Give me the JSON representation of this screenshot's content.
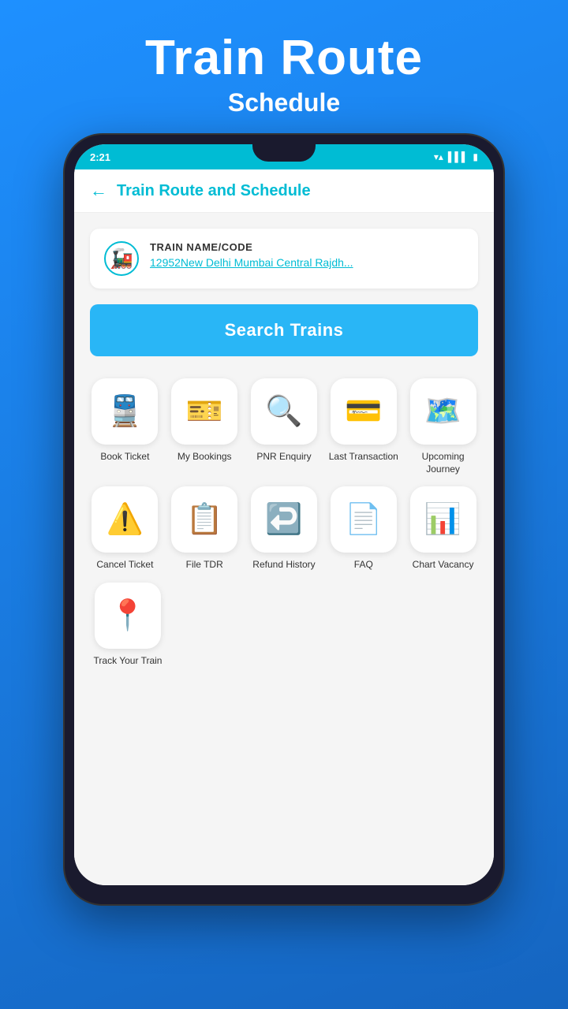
{
  "header": {
    "title": "Train Route",
    "subtitle": "Schedule"
  },
  "status_bar": {
    "time": "2:21",
    "icons": [
      "●",
      "▲",
      "▮",
      "▸",
      "▸"
    ]
  },
  "app_header": {
    "back_label": "←",
    "title": "Train Route and Schedule"
  },
  "train_card": {
    "label": "TRAIN NAME/CODE",
    "train_name": "12952New Delhi Mumbai Central Rajdh..."
  },
  "search_button": {
    "label": "Search Trains"
  },
  "grid": {
    "rows": [
      [
        {
          "id": "book-ticket",
          "label": "Book\nTicket",
          "icon": "🚆",
          "icon_class": "icon-book"
        },
        {
          "id": "my-bookings",
          "label": "My\nBookings",
          "icon": "🎫",
          "icon_class": "icon-booking"
        },
        {
          "id": "pnr-enquiry",
          "label": "PNR\nEnquiry",
          "icon": "🔍",
          "icon_class": "icon-pnr"
        },
        {
          "id": "last-transaction",
          "label": "Last\nTransaction",
          "icon": "💳",
          "icon_class": "icon-transaction"
        },
        {
          "id": "upcoming-journey",
          "label": "Upcoming\nJourney",
          "icon": "🗺️",
          "icon_class": "icon-upcoming"
        }
      ],
      [
        {
          "id": "cancel-ticket",
          "label": "Cancel\nTicket",
          "icon": "⚠️",
          "icon_class": "icon-cancel"
        },
        {
          "id": "file-tdr",
          "label": "File TDR",
          "icon": "📋",
          "icon_class": "icon-tdr"
        },
        {
          "id": "refund-history",
          "label": "Refund\nHistory",
          "icon": "↩️",
          "icon_class": "icon-refund"
        },
        {
          "id": "faq",
          "label": "FAQ",
          "icon": "📄",
          "icon_class": "icon-faq"
        },
        {
          "id": "chart-vacancy",
          "label": "Chart\nVacancy",
          "icon": "📊",
          "icon_class": "icon-chart"
        }
      ],
      [
        {
          "id": "track-your-train",
          "label": "Track Your\nTrain",
          "icon": "📍",
          "icon_class": "icon-track"
        }
      ]
    ]
  }
}
